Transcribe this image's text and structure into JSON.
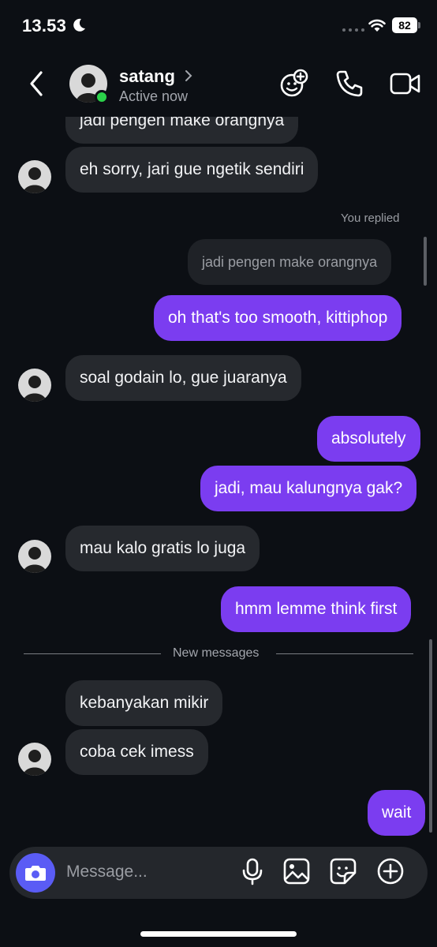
{
  "status_bar": {
    "time": "13.53",
    "battery": "82"
  },
  "header": {
    "contact_name": "satang",
    "status": "Active now"
  },
  "messages": {
    "m0": "jadi pengen make orangnya",
    "m1": "eh sorry, jari gue ngetik sendiri",
    "replied_label": "You replied",
    "quoted": "jadi pengen make orangnya",
    "m2": "oh that's too smooth, kittiphop",
    "m3": "soal godain lo, gue juaranya",
    "m4": "absolutely",
    "m5": "jadi, mau kalungnya gak?",
    "m6": "mau kalo gratis lo juga",
    "m7": "hmm lemme think first",
    "divider": "New messages",
    "m8": "kebanyakan mikir",
    "m9": "coba cek imess",
    "m10": "wait"
  },
  "composer": {
    "placeholder": "Message..."
  },
  "colors": {
    "outgoing": "#7b3df0",
    "incoming": "#26292e",
    "background": "#0c0f14",
    "online": "#2bd24a",
    "camera": "#5a5cf5"
  },
  "icons": [
    "moon-icon",
    "wifi-icon",
    "back-arrow-icon",
    "chevron-right-icon",
    "add-people-icon",
    "phone-icon",
    "video-icon",
    "camera-icon",
    "microphone-icon",
    "gallery-icon",
    "sticker-icon",
    "plus-circle-icon"
  ]
}
